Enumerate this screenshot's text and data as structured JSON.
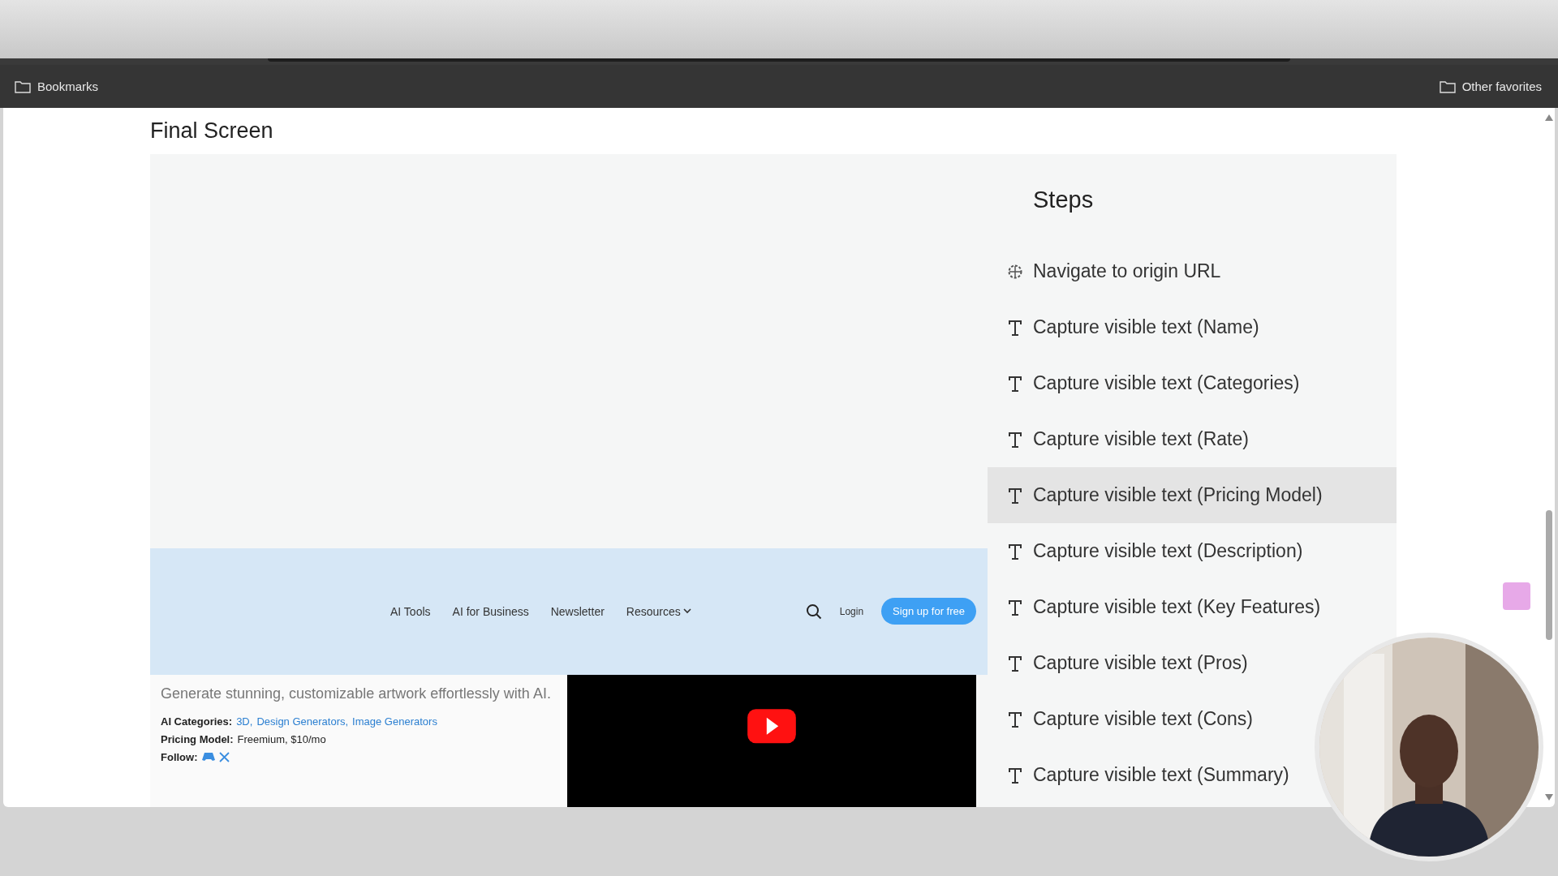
{
  "browser": {
    "bookmarks": "Bookmarks",
    "other_favorites": "Other favorites"
  },
  "page": {
    "title": "Final Screen",
    "preview": {
      "nav": [
        {
          "label": "AI Tools",
          "kind": "link"
        },
        {
          "label": "AI for Business",
          "kind": "link"
        },
        {
          "label": "Newsletter",
          "kind": "link"
        },
        {
          "label": "Resources",
          "kind": "dropdown"
        }
      ],
      "login": "Login",
      "signup": "Sign up for free",
      "tagline": "Generate stunning, customizable artwork effortlessly with AI.",
      "categories": {
        "label": "AI Categories:",
        "links": [
          "3D,",
          "Design Generators,",
          "Image Generators"
        ]
      },
      "pricing": {
        "label": "Pricing Model:",
        "value": "Freemium, $10/mo"
      },
      "follow": {
        "label": "Follow:"
      }
    }
  },
  "steps": {
    "title": "Steps",
    "items": [
      {
        "kind": "navigate",
        "label": "Navigate to origin URL",
        "selected": false
      },
      {
        "kind": "text",
        "label": "Capture visible text (Name)",
        "selected": false
      },
      {
        "kind": "text",
        "label": "Capture visible text (Categories)",
        "selected": false
      },
      {
        "kind": "text",
        "label": "Capture visible text (Rate)",
        "selected": false
      },
      {
        "kind": "text",
        "label": "Capture visible text (Pricing Model)",
        "selected": true
      },
      {
        "kind": "text",
        "label": "Capture visible text (Description)",
        "selected": false
      },
      {
        "kind": "text",
        "label": "Capture visible text (Key Features)",
        "selected": false
      },
      {
        "kind": "text",
        "label": "Capture visible text (Pros)",
        "selected": false
      },
      {
        "kind": "text",
        "label": "Capture visible text (Cons)",
        "selected": false
      },
      {
        "kind": "text",
        "label": "Capture visible text (Summary)",
        "selected": false
      }
    ]
  }
}
